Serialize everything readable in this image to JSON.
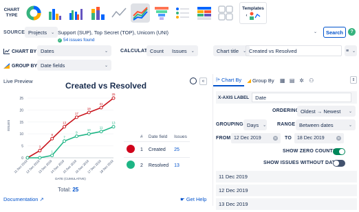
{
  "chart_type_label": "CHART TYPE",
  "templates_label": "Templates",
  "source": {
    "label": "SOURCE",
    "projects_label": "Projects",
    "value": "Support (SUP), Top Secret (TOP), Unicorn (UNI)",
    "found": "54 issues found",
    "search_label": "Search",
    "help": "?"
  },
  "chart_by": {
    "label": "CHART BY",
    "value": "Dates"
  },
  "group_by": {
    "label": "GROUP BY",
    "value": "Date fields"
  },
  "calculate": {
    "label": "CALCULATE",
    "count": "Count",
    "issues": "Issues"
  },
  "chart_title": {
    "label": "Chart title",
    "value": "Created vs Resolved"
  },
  "preview": {
    "label": "Live Preview",
    "title": "Created vs Resolved",
    "total_label": "Total:",
    "total_value": "25",
    "documentation": "Documentation",
    "get_help": "Get Help"
  },
  "chart_data": {
    "type": "line",
    "title": "Created vs Resolved",
    "xlabel": "DATE (CUMULATIVE)",
    "ylabel": "ISSUES",
    "categories": [
      "11 Dec 2019",
      "12 Dec 2019",
      "13 Dec 2019",
      "14 Dec 2019",
      "15 Dec 2019",
      "16 Dec 2019",
      "17 Dec 2019",
      "18 Dec 2019"
    ],
    "yticks": [
      0,
      5,
      10,
      15,
      20,
      25
    ],
    "ylim": [
      0,
      27
    ],
    "series": [
      {
        "name": "Created",
        "color": "#c9141c",
        "values": [
          0,
          3,
          8,
          13,
          17,
          19,
          21,
          25
        ]
      },
      {
        "name": "Resolved",
        "color": "#1db585",
        "values": [
          0,
          0,
          1,
          7,
          9,
          10,
          11,
          13
        ]
      }
    ]
  },
  "legend": {
    "headers": [
      "#",
      "Date field",
      "Issues"
    ],
    "rows": [
      {
        "index": "1",
        "name": "Created",
        "count": "25",
        "color": "#d0021b"
      },
      {
        "index": "2",
        "name": "Resolved",
        "count": "13",
        "color": "#1db585"
      }
    ]
  },
  "panel": {
    "tabs": [
      "Chart By",
      "Group By"
    ],
    "xaxis_label_key": "X-AXIS LABEL",
    "xaxis_label_value": "Date",
    "ordering_label": "ORDERING",
    "ordering_value": "Oldest → Newest",
    "grouping_label": "GROUPING",
    "grouping_value": "Days",
    "range_label": "RANGE",
    "range_value": "Between dates",
    "from_label": "FROM",
    "from_value": "12 Dec 2019",
    "to_label": "TO",
    "to_value": "18 Dec 2019",
    "show_zero_label": "SHOW ZERO COUNTS",
    "show_zero_on": true,
    "show_nodates_label": "SHOW ISSUES WITHOUT DATES",
    "show_nodates_on": false,
    "dates": [
      "11 Dec 2019",
      "12 Dec 2019",
      "13 Dec 2019"
    ]
  }
}
